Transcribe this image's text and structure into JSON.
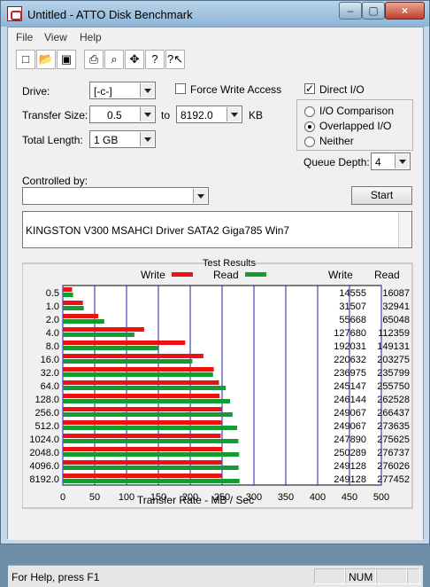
{
  "window": {
    "title": "Untitled - ATTO Disk Benchmark"
  },
  "menu": {
    "file": "File",
    "view": "View",
    "help": "Help"
  },
  "toolbar": {
    "tools": [
      "new",
      "open",
      "save",
      "print",
      "print-preview",
      "move",
      "help",
      "context-help"
    ]
  },
  "form": {
    "drive_label": "Drive:",
    "drive_value": "[-c-]",
    "force_write_label": "Force Write Access",
    "direct_io_label": "Direct I/O",
    "transfer_size_label": "Transfer Size:",
    "transfer_from": "0.5",
    "to_label": "to",
    "transfer_to": "8192.0",
    "kb_label": "KB",
    "total_length_label": "Total Length:",
    "total_length_value": "1 GB",
    "io_comparison_label": "I/O Comparison",
    "overlapped_io_label": "Overlapped I/O",
    "neither_label": "Neither",
    "queue_depth_label": "Queue Depth:",
    "queue_depth_value": "4",
    "controlled_by_label": "Controlled by:",
    "start_label": "Start",
    "description": "KINGSTON V300 MSAHCI Driver SATA2 Giga785 Win7"
  },
  "chart_data": {
    "type": "bar",
    "title": "Test Results",
    "xlabel": "Transfer Rate - MB / Sec",
    "xlim": [
      0,
      500
    ],
    "x_ticks": [
      "0",
      "50",
      "100",
      "150",
      "200",
      "250",
      "300",
      "350",
      "400",
      "450",
      "500"
    ],
    "categories": [
      "0.5",
      "1.0",
      "2.0",
      "4.0",
      "8.0",
      "16.0",
      "32.0",
      "64.0",
      "128.0",
      "256.0",
      "512.0",
      "1024.0",
      "2048.0",
      "4096.0",
      "8192.0"
    ],
    "series": [
      {
        "name": "Write",
        "color": "#ee1111",
        "values": [
          14.555,
          31.507,
          55.668,
          127.68,
          192.031,
          220.632,
          236.975,
          245.147,
          246.144,
          249.067,
          249.067,
          247.89,
          250.289,
          249.128,
          249.128
        ]
      },
      {
        "name": "Read",
        "color": "#139c32",
        "values": [
          16.087,
          32.941,
          65.048,
          112.359,
          149.131,
          203.275,
          235.799,
          255.75,
          262.528,
          266.437,
          273.635,
          275.625,
          276.737,
          276.026,
          277.452
        ]
      }
    ],
    "write_values": [
      "14555",
      "31507",
      "55668",
      "127680",
      "192031",
      "220632",
      "236975",
      "245147",
      "246144",
      "249067",
      "249067",
      "247890",
      "250289",
      "249128",
      "249128"
    ],
    "read_values": [
      "16087",
      "32941",
      "65048",
      "112359",
      "149131",
      "203275",
      "235799",
      "255750",
      "262528",
      "266437",
      "273635",
      "275625",
      "276737",
      "276026",
      "277452"
    ]
  },
  "status": {
    "help": "For Help, press F1",
    "num": "NUM"
  }
}
